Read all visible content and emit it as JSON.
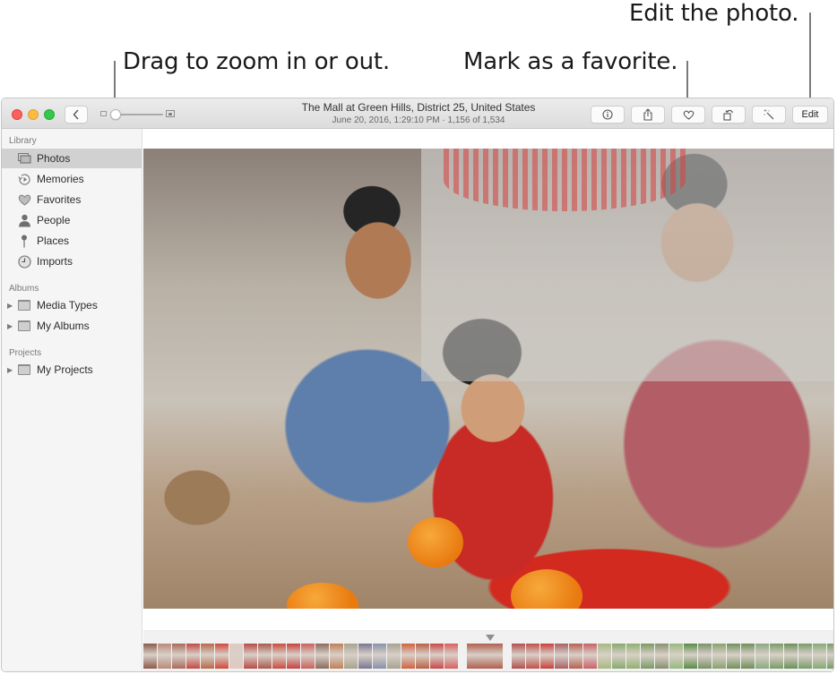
{
  "callouts": {
    "zoom": "Drag to zoom in or out.",
    "favorite": "Mark as a favorite.",
    "edit": "Edit the photo."
  },
  "window": {
    "title": "The Mall at Green Hills, District 25, United States",
    "subtitle": "June 20, 2016, 1:29:10 PM  ·  1,156 of 1,534",
    "zoom_slider_value": 0.0
  },
  "toolbar": {
    "back_icon": "chevron-left-icon",
    "info_icon": "info-icon",
    "share_icon": "share-icon",
    "favorite_icon": "heart-icon",
    "rotate_icon": "rotate-icon",
    "enhance_icon": "magic-wand-icon",
    "edit_label": "Edit"
  },
  "sidebar": {
    "library_header": "Library",
    "library_items": [
      {
        "label": "Photos",
        "icon": "photos-icon",
        "selected": true
      },
      {
        "label": "Memories",
        "icon": "memories-icon",
        "selected": false
      },
      {
        "label": "Favorites",
        "icon": "heart-icon",
        "selected": false
      },
      {
        "label": "People",
        "icon": "person-icon",
        "selected": false
      },
      {
        "label": "Places",
        "icon": "pin-icon",
        "selected": false
      },
      {
        "label": "Imports",
        "icon": "clock-icon",
        "selected": false
      }
    ],
    "albums_header": "Albums",
    "album_items": [
      {
        "label": "Media Types",
        "icon": "folder-icon"
      },
      {
        "label": "My Albums",
        "icon": "folder-icon"
      }
    ],
    "projects_header": "Projects",
    "project_items": [
      {
        "label": "My Projects",
        "icon": "folder-icon"
      }
    ]
  },
  "filmstrip": {
    "colors_before": [
      "#8c5a4a",
      "#b98a7a",
      "#a86a5a",
      "#c24a43",
      "#b7694a",
      "#d04a3a",
      "#e0c8c0",
      "#b84a48",
      "#a8594d",
      "#c94c3c",
      "#c5423f",
      "#c9605a",
      "#8a6a5e",
      "#c07f58",
      "#a7a28d",
      "#7a7690",
      "#8a90a8",
      "#a8a090",
      "#d0623e",
      "#b86045",
      "#c74a48",
      "#d86060"
    ],
    "colors_after": [
      "#b05050",
      "#c0504a",
      "#c8403a",
      "#a86060",
      "#b86050",
      "#c86068",
      "#a8b880",
      "#88a870",
      "#90b070",
      "#7a9a60",
      "#889070",
      "#98b880",
      "#5a8a48",
      "#7a9068",
      "#8aa070",
      "#70905a",
      "#6e8e58",
      "#8aa880",
      "#7a9a68",
      "#6a9058",
      "#7a9a6a",
      "#88a878",
      "#7a9868"
    ],
    "current_color": "#b06050"
  },
  "photo": {
    "description": "Family portrait: two men and a child smiling at a table with oranges and red paper decorations"
  }
}
